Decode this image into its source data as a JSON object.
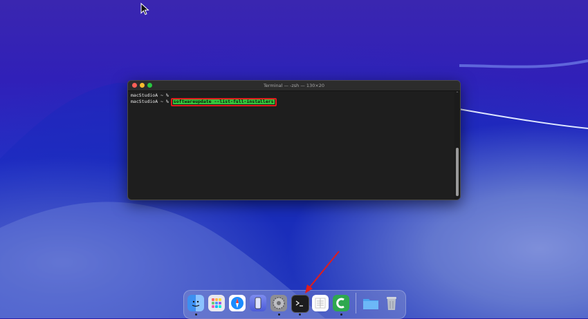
{
  "terminal": {
    "title": "Terminal — -zsh — 130×20",
    "lines": [
      {
        "prompt": "macStudioA ~ %",
        "command": ""
      },
      {
        "prompt": "macStudioA ~ %",
        "command": "softwareupdate --list-full-installers"
      }
    ],
    "highlight_color": "#36c63c",
    "annotation_box_color": "#e01c1c"
  },
  "dock": {
    "items": [
      {
        "name": "finder-icon",
        "running": true
      },
      {
        "name": "launchpad-icon",
        "running": false
      },
      {
        "name": "safari-icon",
        "running": false
      },
      {
        "name": "iphone-mirroring-icon",
        "running": false
      },
      {
        "name": "system-settings-icon",
        "running": true
      },
      {
        "name": "terminal-icon",
        "running": true
      },
      {
        "name": "textedit-icon",
        "running": false
      },
      {
        "name": "camtasia-icon",
        "running": true
      },
      {
        "name": "downloads-folder-icon",
        "running": false
      },
      {
        "name": "trash-icon",
        "running": false
      }
    ]
  },
  "annotation": {
    "arrow_color": "#e01c1c",
    "points_to": "terminal-icon"
  }
}
